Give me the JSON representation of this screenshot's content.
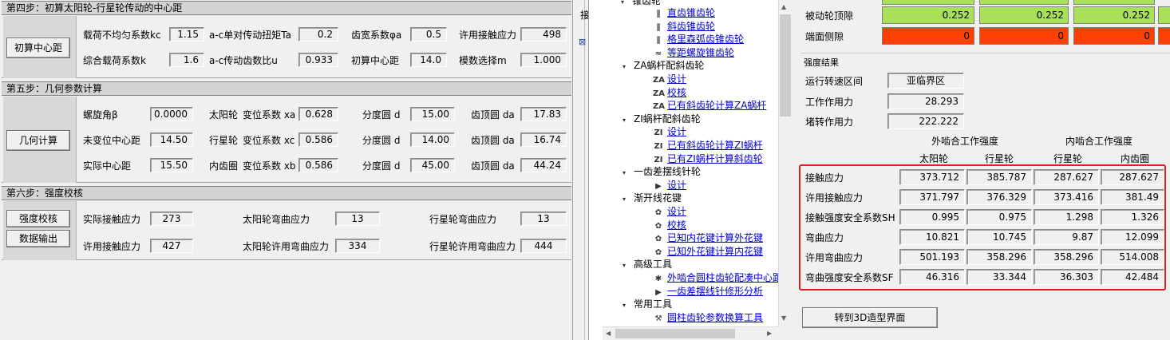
{
  "step4": {
    "header": "第四步：初算太阳轮-行星轮传动的中心距",
    "button": "初算中心距",
    "row1": [
      {
        "label": "载荷不均匀系数kc",
        "value": "1.15"
      },
      {
        "label": "a-c单对传动扭矩Ta",
        "value": "0.2"
      },
      {
        "label": "齿宽系数φa",
        "value": "0.5"
      },
      {
        "label": "许用接触应力",
        "value": "498"
      }
    ],
    "row2": [
      {
        "label": "综合载荷系数k",
        "value": "1.6"
      },
      {
        "label": "a-c传动齿数比u",
        "value": "0.933"
      },
      {
        "label": "初算中心距",
        "value": "14.0"
      },
      {
        "label": "模数选择m",
        "value": "1.000"
      }
    ]
  },
  "step5": {
    "header": "第五步：几何参数计算",
    "button": "几何计算",
    "rows": [
      {
        "a_label": "螺旋角β",
        "a_value": "0.0000",
        "gear": "太阳轮",
        "coef_label": "变位系数 xa",
        "coef_value": "0.628",
        "d_label": "分度圆 d",
        "d_value": "15.00",
        "da_label": "齿顶圆 da",
        "da_value": "17.83"
      },
      {
        "a_label": "未变位中心距",
        "a_value": "14.50",
        "gear": "行星轮",
        "coef_label": "变位系数 xc",
        "coef_value": "0.586",
        "d_label": "分度圆 d",
        "d_value": "14.00",
        "da_label": "齿顶圆 da",
        "da_value": "16.74"
      },
      {
        "a_label": "实际中心距",
        "a_value": "15.50",
        "gear": "内齿圈",
        "coef_label": "变位系数 xb",
        "coef_value": "0.586",
        "d_label": "分度圆 d",
        "d_value": "45.00",
        "da_label": "齿顶圆 da",
        "da_value": "44.24"
      }
    ]
  },
  "step6": {
    "header": "第六步：强度校核",
    "button1": "强度校核",
    "button2": "数据输出",
    "row1": [
      {
        "label": "实际接触应力",
        "value": "273"
      },
      {
        "label": "太阳轮弯曲应力",
        "value": "13"
      },
      {
        "label": "行星轮弯曲应力",
        "value": "13"
      }
    ],
    "row2": [
      {
        "label": "许用接触应力",
        "value": "427"
      },
      {
        "label": "太阳轮许用弯曲应力",
        "value": "334"
      },
      {
        "label": "行星轮许用弯曲应力",
        "value": "444"
      }
    ]
  },
  "midstub": {
    "label": "接"
  },
  "tree": {
    "top_partial": "锥齿轮",
    "items": [
      {
        "text": "直齿锥齿轮",
        "link": true,
        "level": 2,
        "icon": "bevel-gear-icon",
        "glyph": "∥"
      },
      {
        "text": "斜齿锥齿轮",
        "link": true,
        "level": 2,
        "icon": "bevel-gear-icon",
        "glyph": "∥"
      },
      {
        "text": "格里森弧齿锥齿轮",
        "link": true,
        "level": 2,
        "icon": "bevel-gear-icon",
        "glyph": "∥"
      },
      {
        "text": "等距螺旋锥齿轮",
        "link": true,
        "level": 2,
        "icon": "spiral-gear-icon",
        "glyph": "≈"
      },
      {
        "text": "ZA蜗杆配斜齿轮",
        "link": false,
        "level": 1,
        "icon": "collapse-icon",
        "glyph": "▾"
      },
      {
        "text": "设计",
        "link": true,
        "level": 2,
        "icon": "za-icon",
        "glyph": "ZA"
      },
      {
        "text": "校核",
        "link": true,
        "level": 2,
        "icon": "za-icon",
        "glyph": "ZA"
      },
      {
        "text": "已有斜齿轮计算ZA蜗杆",
        "link": true,
        "level": 2,
        "icon": "za-icon",
        "glyph": "ZA"
      },
      {
        "text": "ZI蜗杆配斜齿轮",
        "link": false,
        "level": 1,
        "icon": "collapse-icon",
        "glyph": "▾"
      },
      {
        "text": "设计",
        "link": true,
        "level": 2,
        "icon": "zi-icon",
        "glyph": "ZI"
      },
      {
        "text": "已有斜齿轮计算ZI蜗杆",
        "link": true,
        "level": 2,
        "icon": "zi-icon",
        "glyph": "ZI"
      },
      {
        "text": "已有ZI蜗杆计算斜齿轮",
        "link": true,
        "level": 2,
        "icon": "zi-icon",
        "glyph": "ZI"
      },
      {
        "text": "一齿差摆线针轮",
        "link": false,
        "level": 1,
        "icon": "collapse-icon",
        "glyph": "▾"
      },
      {
        "text": "设计",
        "link": true,
        "level": 2,
        "icon": "cycloid-icon",
        "glyph": "▶"
      },
      {
        "text": "渐开线花键",
        "link": false,
        "level": 1,
        "icon": "collapse-icon",
        "glyph": "▾"
      },
      {
        "text": "设计",
        "link": true,
        "level": 2,
        "icon": "spline-icon",
        "glyph": "✿"
      },
      {
        "text": "校核",
        "link": true,
        "level": 2,
        "icon": "spline-icon",
        "glyph": "✿"
      },
      {
        "text": "已知内花键计算外花键",
        "link": true,
        "level": 2,
        "icon": "spline-icon",
        "glyph": "✿"
      },
      {
        "text": "已知外花键计算内花键",
        "link": true,
        "level": 2,
        "icon": "spline-icon",
        "glyph": "✿"
      },
      {
        "text": "高级工具",
        "link": false,
        "level": 1,
        "icon": "collapse-icon",
        "glyph": "▾"
      },
      {
        "text": "外啮合圆柱齿轮配凑中心距",
        "link": true,
        "level": 2,
        "icon": "gear-icon",
        "glyph": "✱"
      },
      {
        "text": "一齿差摆线针修形分析",
        "link": true,
        "level": 2,
        "icon": "cycloid-icon",
        "glyph": "▶"
      },
      {
        "text": "常用工具",
        "link": false,
        "level": 1,
        "icon": "collapse-icon",
        "glyph": "▾"
      },
      {
        "text": "圆柱齿轮参数换算工具",
        "link": true,
        "level": 2,
        "icon": "tool-icon",
        "glyph": "⚒"
      }
    ]
  },
  "right": {
    "top_rows": [
      {
        "label": "被动轮顶隙",
        "color": "#a8e05a",
        "values": [
          "0.252",
          "0.252",
          "0.252"
        ]
      },
      {
        "label": "端面侧隙",
        "color": "#ff4000",
        "values": [
          "0",
          "0",
          "0"
        ]
      }
    ],
    "strength_title": "强度结果",
    "info": [
      {
        "label": "运行转速区间",
        "value": "亚临界区"
      },
      {
        "label": "工作作用力",
        "value": "28.293"
      },
      {
        "label": "堵转作用力",
        "value": "222.222"
      }
    ],
    "group_headers": [
      "外啮合工作强度",
      "内啮合工作强度"
    ],
    "col_headers": [
      "太阳轮",
      "行星轮",
      "行星轮",
      "内齿圈"
    ],
    "table": [
      {
        "label": "接触应力",
        "values": [
          "373.712",
          "385.787",
          "287.627",
          "287.627"
        ]
      },
      {
        "label": "许用接触应力",
        "values": [
          "371.797",
          "376.329",
          "373.416",
          "381.49"
        ]
      },
      {
        "label": "接触强度安全系数SH",
        "values": [
          "0.995",
          "0.975",
          "1.298",
          "1.326"
        ]
      },
      {
        "label": "弯曲应力",
        "values": [
          "10.821",
          "10.745",
          "9.87",
          "12.099"
        ]
      },
      {
        "label": "许用弯曲应力",
        "values": [
          "501.193",
          "358.296",
          "358.296",
          "514.008"
        ]
      },
      {
        "label": "弯曲强度安全系数SF",
        "values": [
          "46.316",
          "33.344",
          "36.303",
          "42.484"
        ]
      }
    ],
    "button_3d": "转到3D造型界面"
  }
}
